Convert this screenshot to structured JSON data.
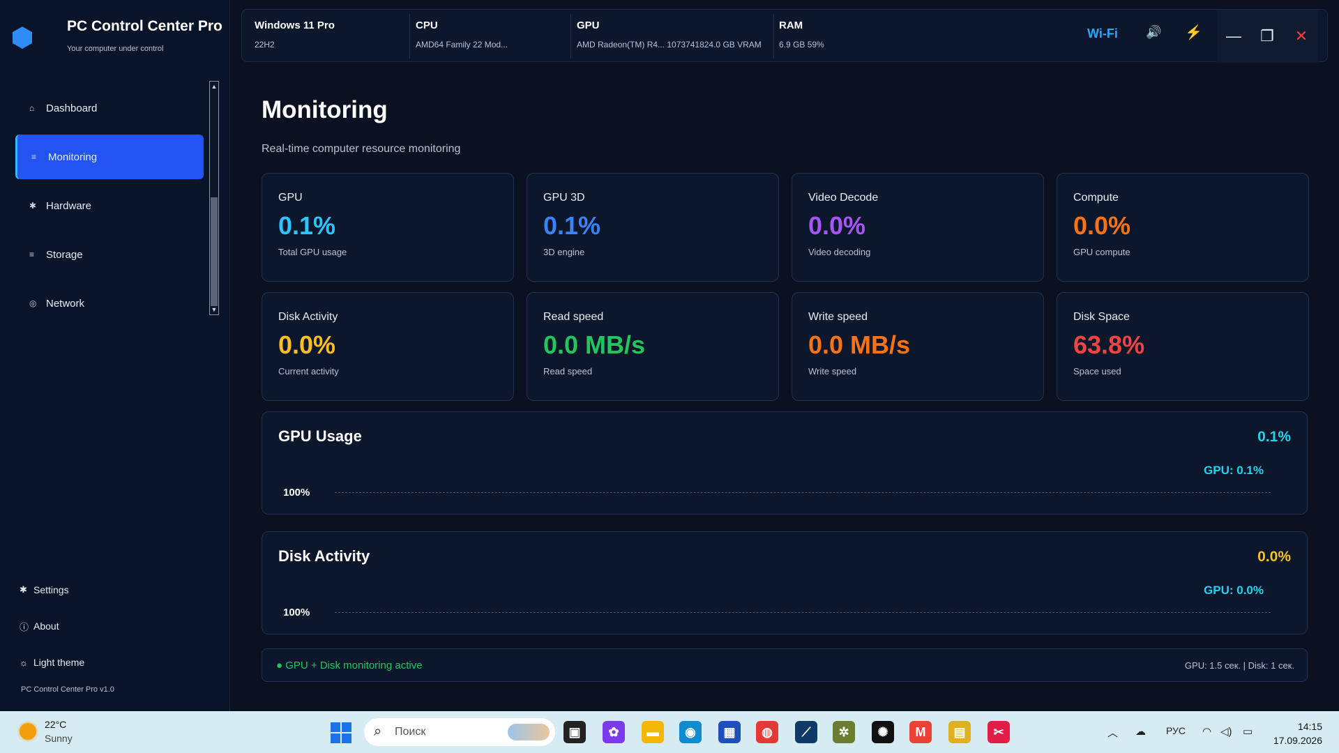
{
  "app": {
    "title": "PC Control Center Pro",
    "subtitle": "Your computer under control",
    "version": "PC Control Center Pro v1.0"
  },
  "sidebar": {
    "items": [
      {
        "label": "Dashboard",
        "icon": "home-icon",
        "glyph": "⌂",
        "active": false
      },
      {
        "label": "Monitoring",
        "icon": "monitor-icon",
        "glyph": "≡",
        "active": true
      },
      {
        "label": "Hardware",
        "icon": "gear-icon",
        "glyph": "✱",
        "active": false
      },
      {
        "label": "Storage",
        "icon": "storage-icon",
        "glyph": "≡",
        "active": false
      },
      {
        "label": "Network",
        "icon": "network-icon",
        "glyph": "◎",
        "active": false
      }
    ],
    "bottom": {
      "settings": {
        "label": "Settings",
        "glyph": "✱"
      },
      "about": {
        "label": "About",
        "glyph": "ⓘ"
      },
      "theme": {
        "label": "Light theme",
        "glyph": "☼"
      }
    }
  },
  "topbar": {
    "os": {
      "title": "Windows 11 Pro",
      "detail": "22H2"
    },
    "cpu": {
      "title": "CPU",
      "detail": "AMD64 Family 22 Mod..."
    },
    "gpu": {
      "title": "GPU",
      "detail": "AMD Radeon(TM) R4...   1073741824.0 GB VRAM"
    },
    "ram": {
      "title": "RAM",
      "detail": "6.9 GB   59%"
    },
    "wifi": "Wi-Fi",
    "speaker_glyph": "🔊",
    "power_glyph": "⚡",
    "window_controls": {
      "minimize": "—",
      "maximize": "❐",
      "close": "✕"
    }
  },
  "page": {
    "title": "Monitoring",
    "subtitle": "Real-time computer resource monitoring"
  },
  "cards": [
    {
      "label": "GPU",
      "value": "0.1%",
      "desc": "Total GPU usage",
      "color": "#2ec5ff"
    },
    {
      "label": "GPU 3D",
      "value": "0.1%",
      "desc": "3D engine",
      "color": "#3b82f6"
    },
    {
      "label": "Video Decode",
      "value": "0.0%",
      "desc": "Video decoding",
      "color": "#a855f7"
    },
    {
      "label": "Compute",
      "value": "0.0%",
      "desc": "GPU compute",
      "color": "#f97316"
    },
    {
      "label": "Disk Activity",
      "value": "0.0%",
      "desc": "Current activity",
      "color": "#fbbf24"
    },
    {
      "label": "Read speed",
      "value": "0.0 MB/s",
      "desc": "Read speed",
      "color": "#22c55e"
    },
    {
      "label": "Write speed",
      "value": "0.0 MB/s",
      "desc": "Write speed",
      "color": "#f97316"
    },
    {
      "label": "Disk Space",
      "value": "63.8%",
      "desc": "Space used",
      "color": "#ef4444"
    }
  ],
  "panels": [
    {
      "title": "GPU Usage",
      "value": "0.1%",
      "value_color": "#22d3ee",
      "legend": "GPU: 0.1%",
      "axis": "100%"
    },
    {
      "title": "Disk Activity",
      "value": "0.0%",
      "value_color": "#fbbf24",
      "legend": "GPU: 0.0%",
      "axis": "100%"
    }
  ],
  "status": {
    "left": "● GPU + Disk monitoring active",
    "right": "GPU: 1.5 сек.  |  Disk: 1 сек."
  },
  "taskbar": {
    "weather": {
      "temp": "22°C",
      "cond": "Sunny"
    },
    "search_placeholder": "Поиск",
    "lang": "РУС",
    "time": "14:15",
    "date": "17.09.2026",
    "apps": [
      {
        "name": "task-view-icon",
        "glyph": "▣",
        "color": "#222"
      },
      {
        "name": "copilot-icon",
        "glyph": "✿",
        "color": "#7c3aed"
      },
      {
        "name": "file-explorer-icon",
        "glyph": "▬",
        "color": "#f2b705"
      },
      {
        "name": "edge-icon",
        "glyph": "◉",
        "color": "#0e8bd1"
      },
      {
        "name": "store-icon",
        "glyph": "▦",
        "color": "#1f4fb8"
      },
      {
        "name": "chrome-icon",
        "glyph": "◍",
        "color": "#e53935"
      },
      {
        "name": "app-dark-icon",
        "glyph": "⟋",
        "color": "#0f3a66"
      },
      {
        "name": "app-gear-icon",
        "glyph": "✲",
        "color": "#6b7d2f"
      },
      {
        "name": "chatgpt-icon",
        "glyph": "✺",
        "color": "#111"
      },
      {
        "name": "gmail-icon",
        "glyph": "M",
        "color": "#ea4335"
      },
      {
        "name": "save-app-icon",
        "glyph": "▤",
        "color": "#e0b020"
      },
      {
        "name": "snipping-icon",
        "glyph": "✂",
        "color": "#e11d48"
      }
    ]
  }
}
